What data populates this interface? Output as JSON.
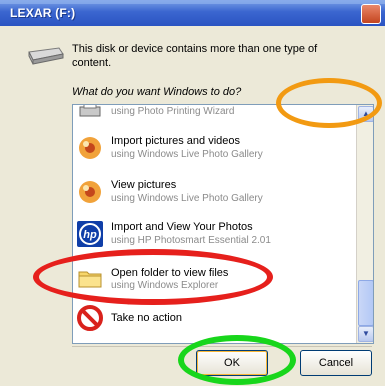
{
  "window": {
    "title": "LEXAR (F:)",
    "description": "This disk or device contains more than one type of content.",
    "question": "What do you want Windows to do?"
  },
  "list_items": [
    {
      "title": "",
      "subtitle": "using Photo Printing Wizard",
      "icon": "printer-icon"
    },
    {
      "title": "Import pictures and videos",
      "subtitle": "using Windows Live Photo Gallery",
      "icon": "photo-gallery-icon"
    },
    {
      "title": "View pictures",
      "subtitle": "using Windows Live Photo Gallery",
      "icon": "photo-gallery-icon"
    },
    {
      "title": "Import and View Your Photos",
      "subtitle": "using HP Photosmart Essential 2.01",
      "icon": "hp-logo-icon"
    },
    {
      "title": "Open folder to view files",
      "subtitle": "using Windows Explorer",
      "icon": "folder-icon"
    },
    {
      "title": "Take no action",
      "subtitle": "",
      "icon": "no-action-icon"
    }
  ],
  "buttons": {
    "ok": "OK",
    "cancel": "Cancel"
  },
  "annotation_colors": {
    "orange": "#f29a12",
    "red": "#e6201c",
    "green": "#18d61b"
  }
}
